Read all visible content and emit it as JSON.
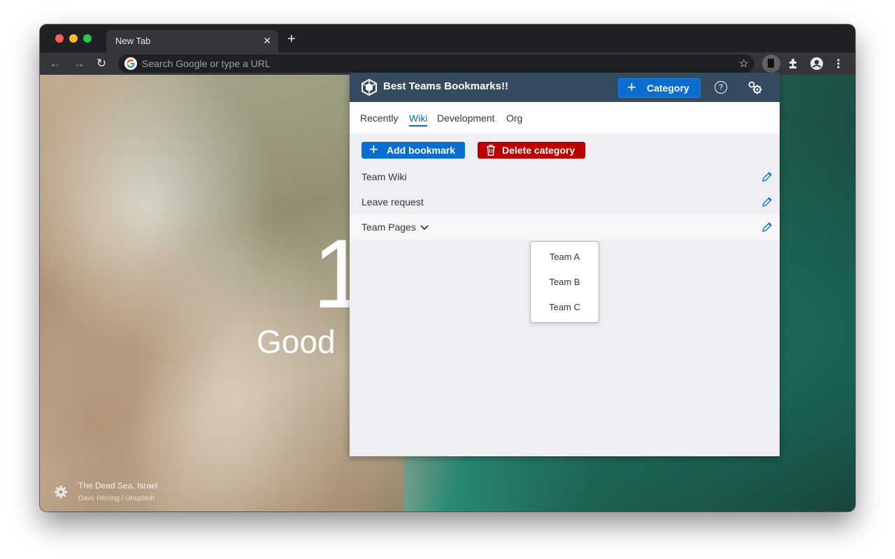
{
  "browser": {
    "tab_title": "New Tab",
    "tab_close": "✕",
    "new_tab": "+",
    "omnibox_placeholder": "Search Google or type a URL",
    "icons": [
      "back-icon",
      "forward-icon",
      "reload-icon",
      "google-icon",
      "star-icon",
      "bookmark-extension-icon",
      "puzzle-icon",
      "profile-icon",
      "kebab-menu-icon"
    ],
    "traffic_lights": [
      "#ff5f57",
      "#febc2e",
      "#28c840"
    ]
  },
  "newtab_page": {
    "time_partial": "1",
    "greeting_partial": "Good",
    "photo_location": "The Dead Sea, Israel",
    "photo_credit": "Dave Herring / Unsplash"
  },
  "popup": {
    "title": "Best Teams Bookmarks!!",
    "category_button": "Category",
    "help_symbol": "?",
    "tabs": [
      "Recently",
      "Wiki",
      "Development",
      "Org"
    ],
    "active_tab": "Wiki",
    "add_bookmark_button": "Add bookmark",
    "delete_category_button": "Delete category",
    "bookmarks": [
      "Team Wiki",
      "Leave request",
      "Team Pages"
    ],
    "dropdown_items": [
      "Team A",
      "Team B",
      "Team C"
    ],
    "colors": {
      "header": "#354a5f",
      "primary": "#0a6ed1",
      "danger": "#bb0000",
      "background": "#edeff2"
    }
  }
}
